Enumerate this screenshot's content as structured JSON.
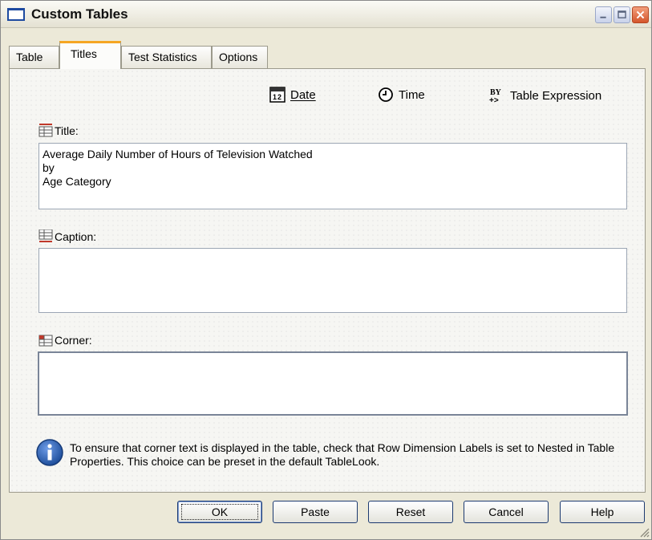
{
  "window": {
    "title": "Custom Tables"
  },
  "tabs": [
    {
      "label": "Table"
    },
    {
      "label": "Titles"
    },
    {
      "label": "Test Statistics"
    },
    {
      "label": "Options"
    }
  ],
  "insert": {
    "date": "Date",
    "time": "Time",
    "expression": "Table Expression",
    "expression_icon": "BY"
  },
  "title_field": {
    "label": "Title:",
    "value": "Average Daily Number of Hours of Television Watched\nby\nAge Category"
  },
  "caption_field": {
    "label": "Caption:",
    "value": ""
  },
  "corner_field": {
    "label": "Corner:",
    "value": ""
  },
  "info": {
    "text": "To ensure that corner text is displayed in the table, check that Row Dimension Labels is set to Nested in Table Properties. This choice can be preset in the default TableLook."
  },
  "buttons": {
    "ok": "OK",
    "paste": "Paste",
    "reset": "Reset",
    "cancel": "Cancel",
    "help": "Help"
  },
  "colors": {
    "accent_tab": "#f5a623",
    "info_blue": "#1f4f9c",
    "close_red": "#d4552b"
  }
}
